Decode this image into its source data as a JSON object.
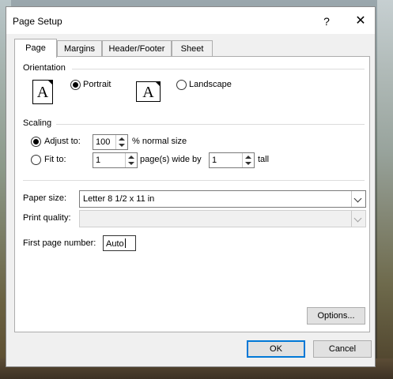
{
  "dialog": {
    "title": "Page Setup",
    "help_glyph": "?",
    "close_glyph": "✕"
  },
  "tabs": [
    {
      "label": "Page",
      "active": true
    },
    {
      "label": "Margins",
      "active": false
    },
    {
      "label": "Header/Footer",
      "active": false
    },
    {
      "label": "Sheet",
      "active": false
    }
  ],
  "orientation": {
    "section_label": "Orientation",
    "page_glyph": "A",
    "portrait_label": "Portrait",
    "landscape_label": "Landscape",
    "selected": "portrait"
  },
  "scaling": {
    "section_label": "Scaling",
    "adjust_label": "Adjust to:",
    "adjust_value": "100",
    "adjust_suffix": "% normal size",
    "fit_label": "Fit to:",
    "fit_wide_value": "1",
    "fit_wide_suffix": "page(s) wide by",
    "fit_tall_value": "1",
    "fit_tall_suffix": "tall",
    "selected": "adjust"
  },
  "paper": {
    "paper_size_label": "Paper size:",
    "paper_size_value": "Letter 8 1/2 x 11 in",
    "print_quality_label": "Print quality:",
    "print_quality_value": "",
    "first_page_label": "First page number:",
    "first_page_value": "Auto"
  },
  "buttons": {
    "options": "Options...",
    "ok": "OK",
    "cancel": "Cancel"
  },
  "colors": {
    "accent": "#0078d7",
    "dialog_bg": "#f0f0f0",
    "panel_bg": "#ffffff"
  },
  "icons": [
    "help-icon",
    "close-icon",
    "portrait-page-icon",
    "landscape-page-icon",
    "spin-up-icon",
    "spin-down-icon",
    "chevron-down-icon"
  ]
}
